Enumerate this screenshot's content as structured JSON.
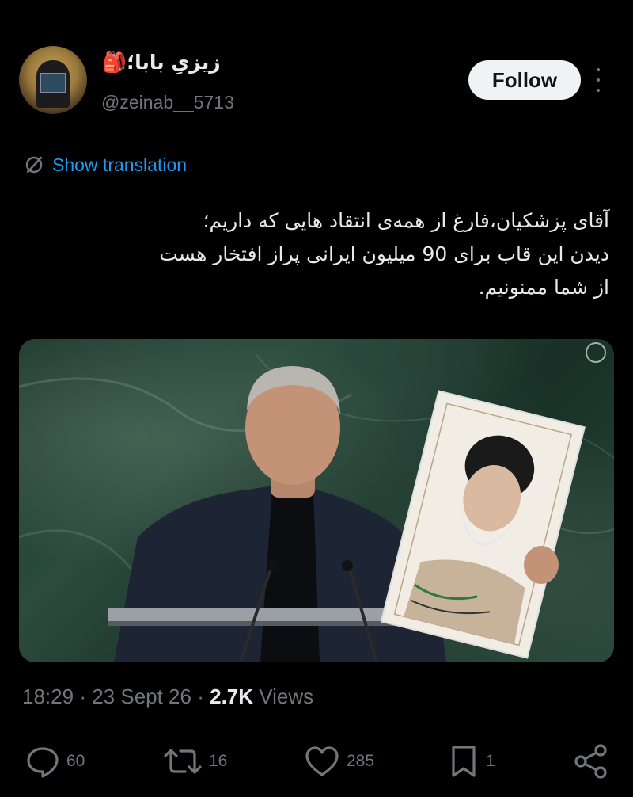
{
  "user": {
    "display_name": "زیزیِ بابا؛🎒",
    "handle": "@zeinab__5713"
  },
  "follow_label": "Follow",
  "translation_label": "Show translation",
  "tweet_lines": [
    "آقای پزشکیان،فارغ از همه‌ی انتقاد هایی که داریم؛",
    "دیدن این قاب برای 90 میلیون ایرانی پراز افتخار هست",
    "از شما ممنونیم."
  ],
  "meta": {
    "time": "18:29",
    "date": "23 Sept 26",
    "views_count": "2.7K",
    "views_label": "Views"
  },
  "actions": {
    "replies": "60",
    "reposts": "16",
    "likes": "285",
    "bookmarks": "1"
  },
  "colors": {
    "background": "#000000",
    "accent": "#1d9bf0",
    "muted": "#71767b",
    "text": "#e7e9ea"
  }
}
